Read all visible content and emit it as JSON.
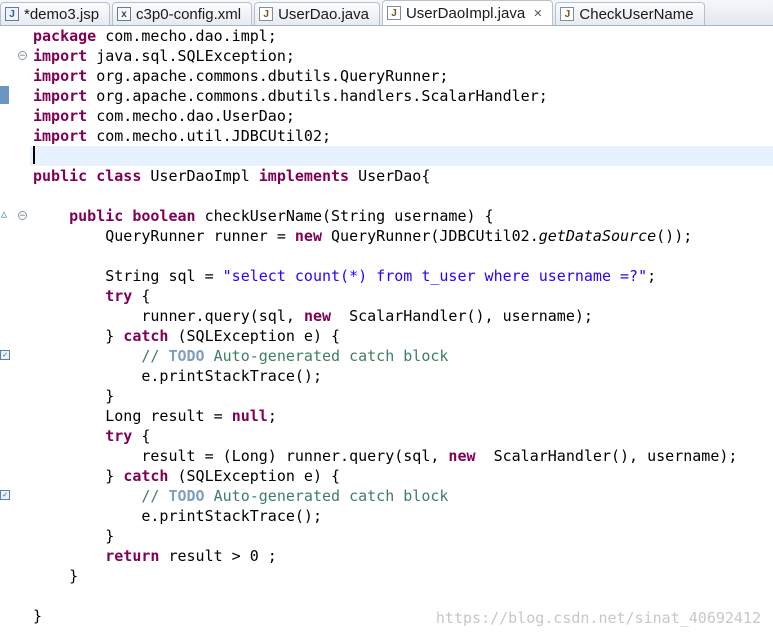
{
  "tabs": [
    {
      "label": "*demo3.jsp",
      "icon": "jsp-file-icon",
      "active": false
    },
    {
      "label": "c3p0-config.xml",
      "icon": "xml-file-icon",
      "active": false
    },
    {
      "label": "UserDao.java",
      "icon": "java-file-icon",
      "active": false
    },
    {
      "label": "UserDaoImpl.java",
      "icon": "java-file-icon",
      "active": true,
      "close": "✕"
    },
    {
      "label": "CheckUserName",
      "icon": "java-file-icon",
      "active": false
    }
  ],
  "code": {
    "l1": {
      "kw": "package",
      "t": " com.mecho.dao.impl;"
    },
    "l2": {
      "kw": "import",
      "t": " java.sql.SQLException;"
    },
    "l3": {
      "kw": "import",
      "t": " org.apache.commons.dbutils.QueryRunner;"
    },
    "l4": {
      "kw": "import",
      "t": " org.apache.commons.dbutils.handlers.ScalarHandler;"
    },
    "l5": {
      "kw": "import",
      "t": " com.mecho.dao.UserDao;"
    },
    "l6": {
      "kw": "import",
      "t": " com.mecho.util.JDBCUtil02;"
    },
    "l8": {
      "kw1": "public",
      "kw2": "class",
      "t1": " UserDaoImpl ",
      "kw3": "implements",
      "t2": " UserDao{"
    },
    "l10": {
      "kw1": "public",
      "kw2": "boolean",
      "t": " checkUserName(String username) {"
    },
    "l11": {
      "t1": "QueryRunner runner = ",
      "kw": "new",
      "t2": " QueryRunner(JDBCUtil02.",
      "it": "getDataSource",
      "t3": "());"
    },
    "l13": {
      "t1": "String sql = ",
      "str": "\"select count(*) from t_user where username =?\"",
      "t2": ";"
    },
    "l14": {
      "kw": "try",
      "t": " {"
    },
    "l15": {
      "t1": "runner.query(sql, ",
      "kw": "new",
      "t2": "  ScalarHandler(), username);"
    },
    "l16": {
      "t1": "} ",
      "kw": "catch",
      "t2": " (SQLException e) {"
    },
    "l17": {
      "c1": "// ",
      "todo": "TODO",
      "c2": " Auto-generated catch block"
    },
    "l18": {
      "t": "e.printStackTrace();"
    },
    "l19": {
      "t": "}"
    },
    "l20": {
      "t1": "Long result = ",
      "kw": "null",
      "t2": ";"
    },
    "l21": {
      "kw": "try",
      "t": " {"
    },
    "l22": {
      "t1": "result = (Long) runner.query(sql, ",
      "kw": "new",
      "t2": "  ScalarHandler(), username);"
    },
    "l23": {
      "t1": "} ",
      "kw": "catch",
      "t2": " (SQLException e) {"
    },
    "l24": {
      "c1": "// ",
      "todo": "TODO",
      "c2": " Auto-generated catch block"
    },
    "l25": {
      "t": "e.printStackTrace();"
    },
    "l26": {
      "t": "}"
    },
    "l27": {
      "kw": "return",
      "t": " result > 0 ;"
    },
    "l28": {
      "t": "}"
    },
    "l30": {
      "t": "}"
    }
  },
  "watermark": "https://blog.csdn.net/sinat_40692412"
}
